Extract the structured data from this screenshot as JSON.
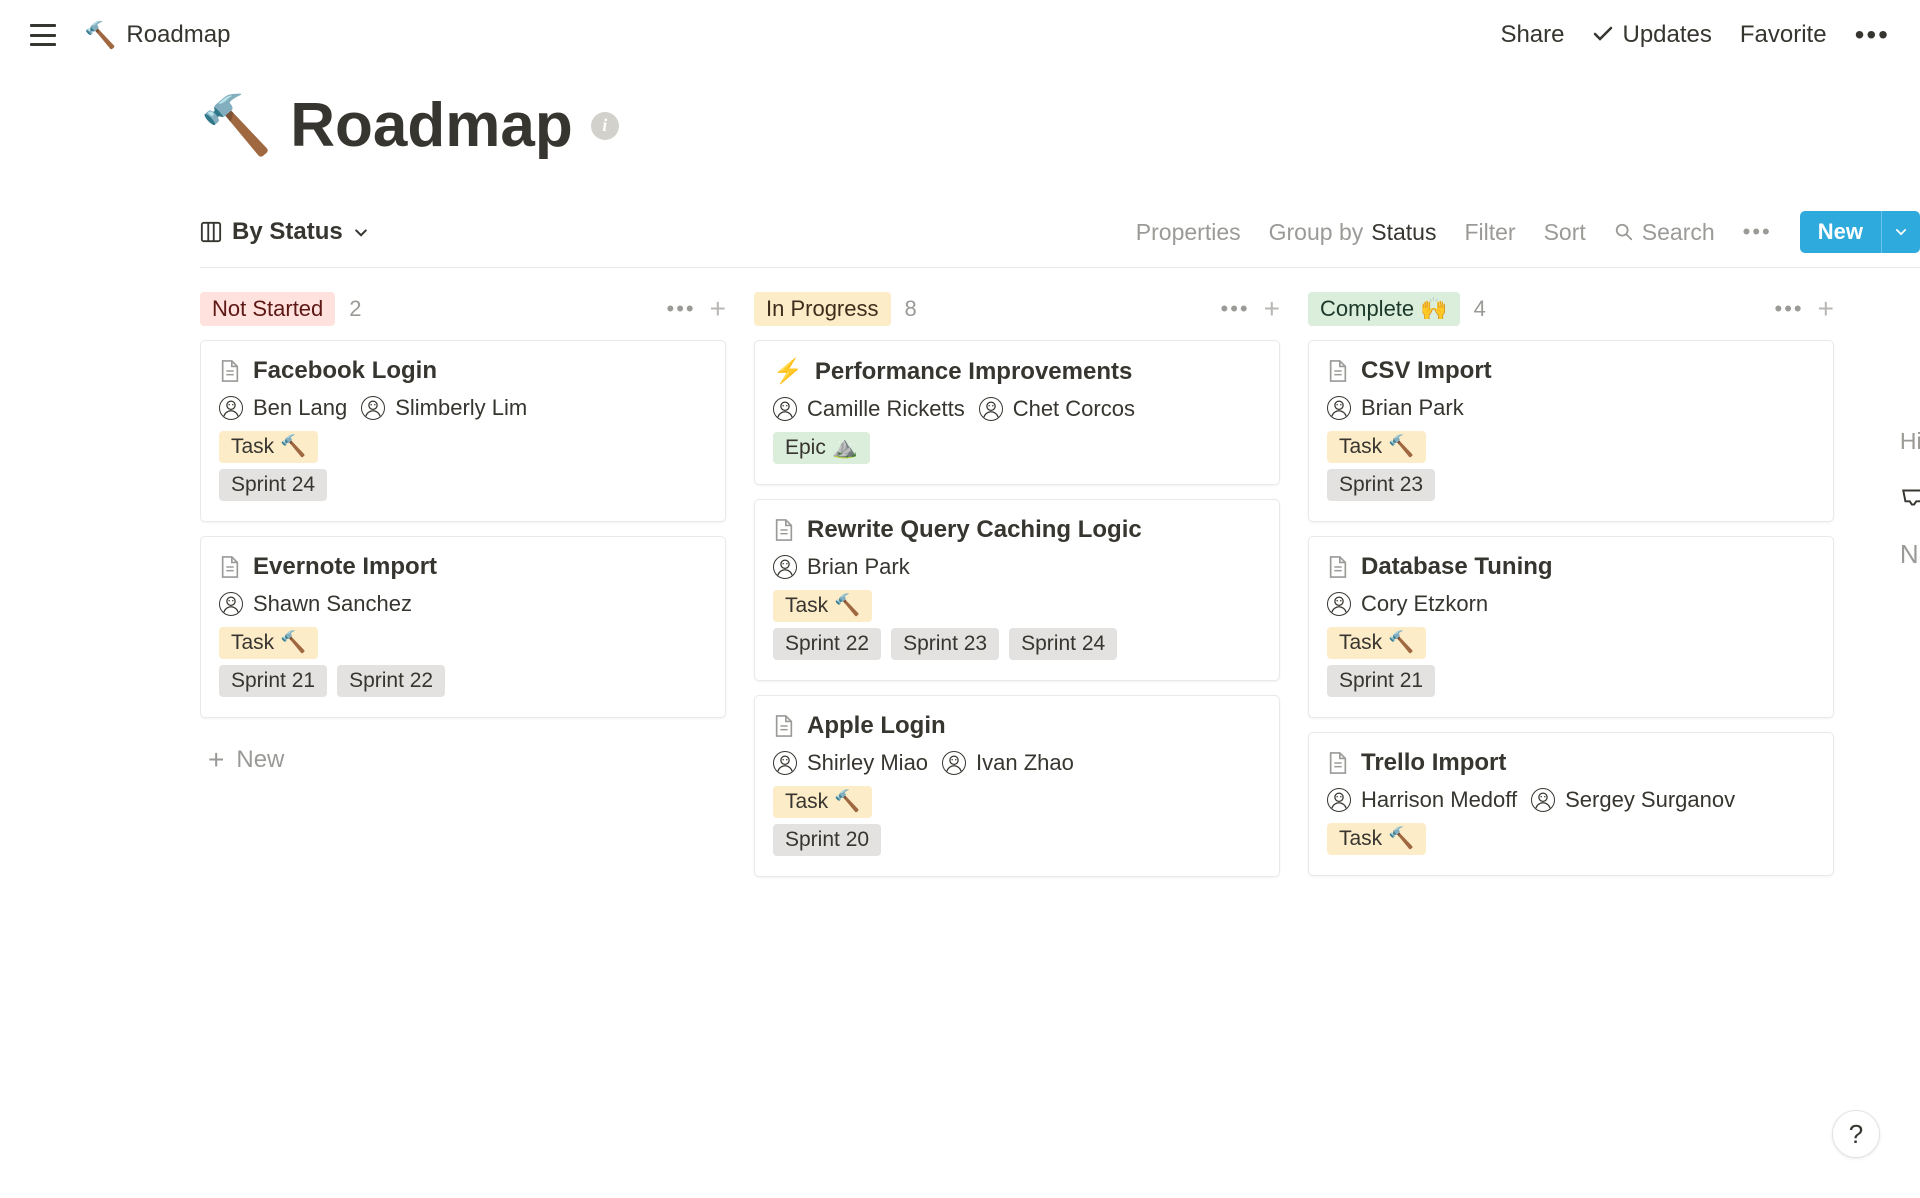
{
  "topbar": {
    "crumb_icon": "🔨",
    "crumb_text": "Roadmap",
    "share": "Share",
    "updates": "Updates",
    "favorite": "Favorite"
  },
  "page": {
    "emoji": "🔨",
    "title": "Roadmap"
  },
  "toolbar": {
    "view_label": "By Status",
    "properties": "Properties",
    "group_by_prefix": "Group by ",
    "group_by_value": "Status",
    "filter": "Filter",
    "sort": "Sort",
    "search": "Search",
    "new": "New"
  },
  "columns": [
    {
      "label": "Not Started",
      "count": "2",
      "bg": "#ffe2dd",
      "fg": "#5d1715",
      "cards": [
        {
          "icon": "doc",
          "title": "Facebook Login",
          "people": [
            "Ben Lang",
            "Slimberly Lim"
          ],
          "type_tag": {
            "text": "Task 🔨",
            "bg": "#fdecc8"
          },
          "sprint_tags": [
            {
              "text": "Sprint 24",
              "bg": "#e3e2e0"
            }
          ]
        },
        {
          "icon": "doc",
          "title": "Evernote Import",
          "people": [
            "Shawn Sanchez"
          ],
          "type_tag": {
            "text": "Task 🔨",
            "bg": "#fdecc8"
          },
          "sprint_tags": [
            {
              "text": "Sprint 21",
              "bg": "#e3e2e0"
            },
            {
              "text": "Sprint 22",
              "bg": "#e3e2e0"
            }
          ]
        }
      ],
      "show_new": true,
      "new_label": "New"
    },
    {
      "label": "In Progress",
      "count": "8",
      "bg": "#fdecc8",
      "fg": "#402c1b",
      "cards": [
        {
          "icon": "emoji",
          "emoji": "⚡",
          "title": "Performance Improvements",
          "people": [
            "Camille Ricketts",
            "Chet Corcos"
          ],
          "type_tag": {
            "text": "Epic ⛰️",
            "bg": "#dbeddb"
          },
          "sprint_tags": []
        },
        {
          "icon": "doc",
          "title": "Rewrite Query Caching Logic",
          "people": [
            "Brian Park"
          ],
          "type_tag": {
            "text": "Task 🔨",
            "bg": "#fdecc8"
          },
          "sprint_tags": [
            {
              "text": "Sprint 22",
              "bg": "#e3e2e0"
            },
            {
              "text": "Sprint 23",
              "bg": "#e3e2e0"
            },
            {
              "text": "Sprint 24",
              "bg": "#e3e2e0"
            }
          ]
        },
        {
          "icon": "doc",
          "title": "Apple Login",
          "people": [
            "Shirley Miao",
            "Ivan Zhao"
          ],
          "type_tag": {
            "text": "Task 🔨",
            "bg": "#fdecc8"
          },
          "sprint_tags": [
            {
              "text": "Sprint 20",
              "bg": "#e3e2e0"
            }
          ]
        }
      ],
      "show_new": false
    },
    {
      "label": "Complete 🙌",
      "count": "4",
      "bg": "#dbeddb",
      "fg": "#1c3829",
      "cards": [
        {
          "icon": "doc",
          "title": "CSV Import",
          "people": [
            "Brian Park"
          ],
          "type_tag": {
            "text": "Task 🔨",
            "bg": "#fdecc8"
          },
          "sprint_tags": [
            {
              "text": "Sprint 23",
              "bg": "#e3e2e0"
            }
          ]
        },
        {
          "icon": "doc",
          "title": "Database Tuning",
          "people": [
            "Cory Etzkorn"
          ],
          "type_tag": {
            "text": "Task 🔨",
            "bg": "#fdecc8"
          },
          "sprint_tags": [
            {
              "text": "Sprint 21",
              "bg": "#e3e2e0"
            }
          ]
        },
        {
          "icon": "doc",
          "title": "Trello Import",
          "people": [
            "Harrison Medoff",
            "Sergey Surganov"
          ],
          "type_tag": {
            "text": "Task 🔨",
            "bg": "#fdecc8"
          },
          "sprint_tags": []
        }
      ],
      "show_new": false
    }
  ],
  "hidden_label": "Hidde",
  "help": "?"
}
